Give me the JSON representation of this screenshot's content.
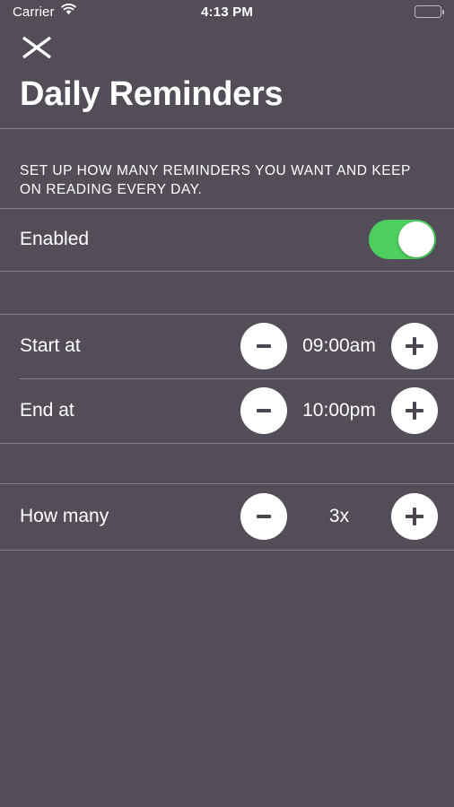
{
  "status_bar": {
    "carrier": "Carrier",
    "wifi_icon": "wifi-icon",
    "time": "4:13 PM",
    "battery_icon": "battery-full-icon"
  },
  "header": {
    "close_icon": "close-icon",
    "title": "Daily Reminders"
  },
  "description": "SET UP HOW MANY REMINDERS YOU WANT AND KEEP ON READING EVERY DAY.",
  "settings": {
    "enabled": {
      "label": "Enabled",
      "value": "on"
    },
    "start_at": {
      "label": "Start at",
      "value": "09:00am",
      "decrement_icon": "minus-icon",
      "increment_icon": "plus-icon"
    },
    "end_at": {
      "label": "End at",
      "value": "10:00pm",
      "decrement_icon": "minus-icon",
      "increment_icon": "plus-icon"
    },
    "how_many": {
      "label": "How many",
      "value": "3x",
      "decrement_icon": "minus-icon",
      "increment_icon": "plus-icon"
    }
  },
  "colors": {
    "background": "#534d58",
    "toggle_on": "#4ccf5f",
    "text": "#ffffff",
    "divider": "rgba(255,255,255,0.30)",
    "glyph": "#4a454f"
  }
}
